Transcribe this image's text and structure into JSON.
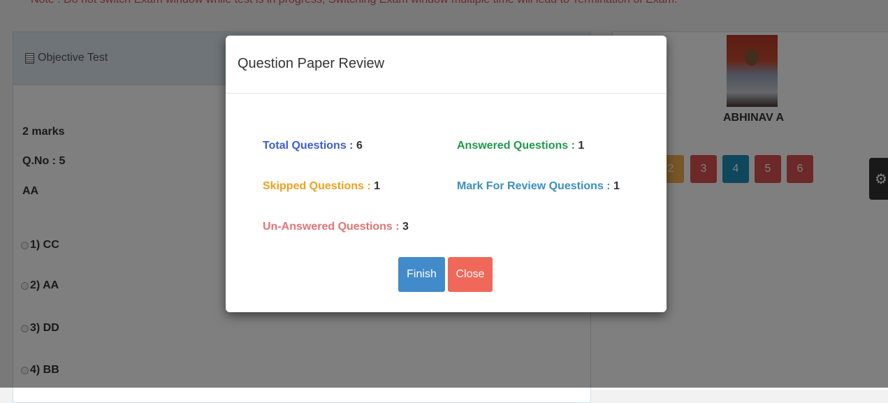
{
  "note": "Note : Do not switch Exam window while test is in progress, Switching Exam window multiple time will lead to Termination of Exam.",
  "panel": {
    "title": "Objective Test"
  },
  "question": {
    "marks": "2 marks",
    "number": "Q.No : 5",
    "text": "AA",
    "options": [
      "1) CC",
      "2) AA",
      "3) DD",
      "4) BB"
    ]
  },
  "student": {
    "name": "ABHINAV A"
  },
  "palette": {
    "buttons": [
      {
        "label": "2",
        "color": "#f0ad4e"
      },
      {
        "label": "3",
        "color": "#d9534f"
      },
      {
        "label": "4",
        "color": "#1f8fb9"
      },
      {
        "label": "5",
        "color": "#d9534f"
      },
      {
        "label": "6",
        "color": "#d9534f"
      }
    ]
  },
  "modal": {
    "title": "Question Paper Review",
    "stats": {
      "total": {
        "label": "Total Questions : ",
        "value": "6",
        "color": "#3b5fd1"
      },
      "answered": {
        "label": "Answered Questions : ",
        "value": "1",
        "color": "#1d9a4a"
      },
      "skipped": {
        "label": "Skipped Questions : ",
        "value": "1",
        "color": "#f0a020"
      },
      "review": {
        "label": "Mark For Review Questions : ",
        "value": "1",
        "color": "#3a8fc1"
      },
      "unanswered": {
        "label": "Un-Answered Questions : ",
        "value": "3",
        "color": "#e57373"
      }
    },
    "finish_label": "Finish",
    "close_label": "Close"
  },
  "colors": {
    "finish": "#428bca",
    "close": "#f0685a"
  }
}
